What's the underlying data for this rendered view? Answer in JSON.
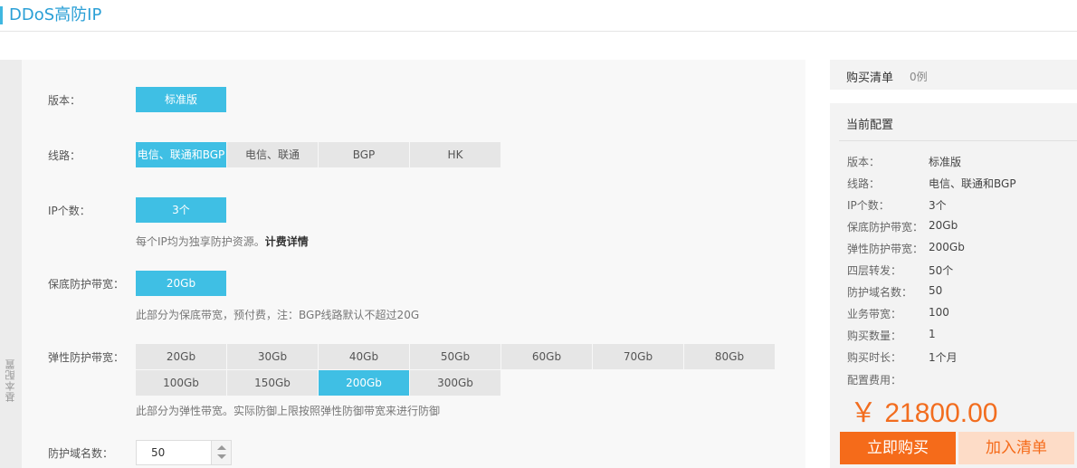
{
  "header": {
    "title": "DDoS高防IP"
  },
  "side_tab": {
    "label": "基本配置"
  },
  "form": {
    "version": {
      "label": "版本：",
      "options": [
        "标准版"
      ]
    },
    "line": {
      "label": "线路：",
      "options": [
        "电信、联通和BGP",
        "电信、联通",
        "BGP",
        "HK"
      ],
      "selected": 0
    },
    "ip_count": {
      "label": "IP个数：",
      "options": [
        "3个"
      ],
      "note": "每个IP均为独享防护资源。",
      "note_link": "计费详情"
    },
    "base_bandwidth": {
      "label": "保底防护带宽：",
      "options": [
        "20Gb"
      ],
      "note": "此部分为保底带宽，预付费，注：BGP线路默认不超过20G"
    },
    "elastic_bandwidth": {
      "label": "弹性防护带宽：",
      "options": [
        "20Gb",
        "30Gb",
        "40Gb",
        "50Gb",
        "60Gb",
        "70Gb",
        "80Gb",
        "100Gb",
        "150Gb",
        "200Gb",
        "300Gb"
      ],
      "selected": 9,
      "note": "此部分为弹性带宽。实际防御上限按照弹性防御带宽来进行防御"
    },
    "domain_count": {
      "label": "防护域名数：",
      "value": "50"
    }
  },
  "cart": {
    "title": "购买清单",
    "count": "0例"
  },
  "config": {
    "title": "当前配置",
    "rows": [
      {
        "k": "版本：",
        "v": "标准版"
      },
      {
        "k": "线路：",
        "v": "电信、联通和BGP"
      },
      {
        "k": "IP个数：",
        "v": "3个"
      },
      {
        "k": "保底防护带宽：",
        "v": "20Gb"
      },
      {
        "k": "弹性防护带宽：",
        "v": "200Gb"
      },
      {
        "k": "四层转发：",
        "v": "50个"
      },
      {
        "k": "防护域名数：",
        "v": "50"
      },
      {
        "k": "业务带宽：",
        "v": "100"
      },
      {
        "k": "购买数量：",
        "v": "1"
      },
      {
        "k": "购买时长：",
        "v": "1个月"
      }
    ],
    "fee_label": "配置费用：",
    "price": "￥ 21800.00",
    "buy_label": "立即购买",
    "add_cart_label": "加入清单"
  },
  "colors": {
    "accent": "#3fbfe4",
    "brand_orange": "#f56b1a",
    "title_blue": "#2a9fd6"
  }
}
